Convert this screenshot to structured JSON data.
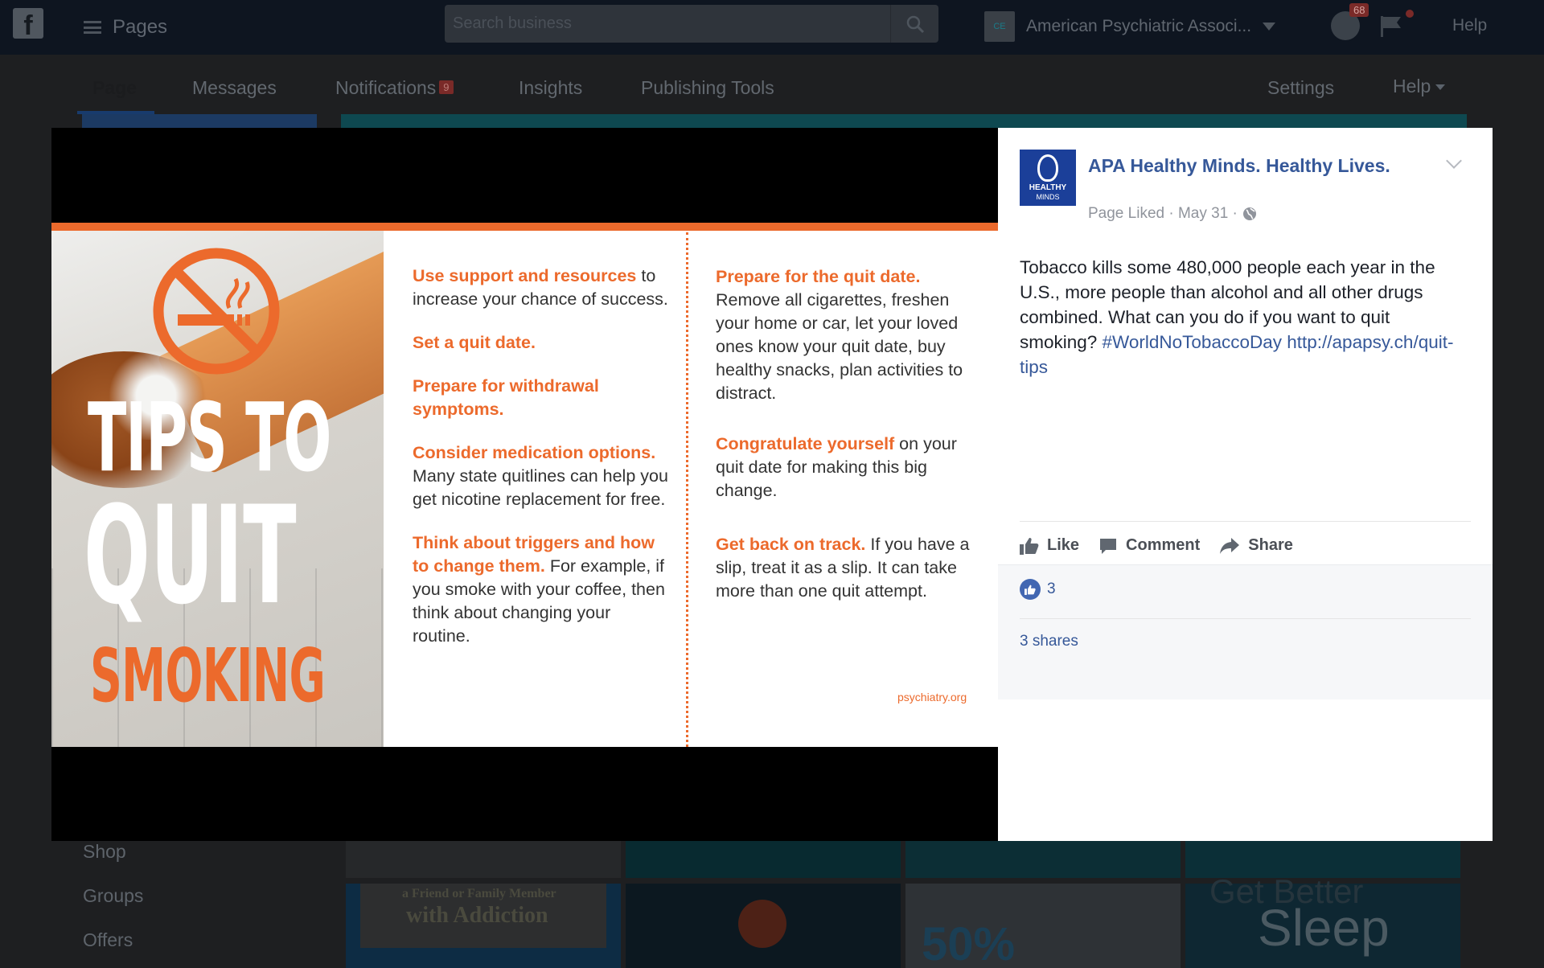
{
  "topbar": {
    "logo": "f",
    "pages_label": "Pages",
    "search_placeholder": "Search business",
    "account_avatar": "CE",
    "account_name": "American Psychiatric Associ...",
    "notifications_badge": "68",
    "help": "Help"
  },
  "subnav": {
    "tabs": [
      {
        "label": "Page"
      },
      {
        "label": "Messages"
      },
      {
        "label": "Notifications",
        "badge": "9"
      },
      {
        "label": "Insights"
      },
      {
        "label": "Publishing Tools"
      }
    ],
    "settings": "Settings",
    "help": "Help"
  },
  "sidebar": {
    "links": [
      "Shop",
      "Groups",
      "Offers"
    ]
  },
  "background_tiles": {
    "tile1_text": "a Friend or Family Member",
    "tile1_text2": "with Addiction",
    "tile2_text": "Get Better",
    "tile2_text2": "Sleep",
    "tile3_text": "50%"
  },
  "infographic": {
    "title_line1": "TIPS TO",
    "title_line2": "QUIT",
    "title_line3": "SMOKING",
    "col1": [
      {
        "highlight": "Use support and resources",
        "text": " to increase your chance of success."
      },
      {
        "highlight": "Set a quit date.",
        "text": ""
      },
      {
        "highlight": "Prepare for withdrawal symptoms.",
        "text": ""
      },
      {
        "highlight": "Consider medication options.",
        "text": " Many state quitlines can help you get nicotine replacement for free."
      },
      {
        "highlight": "Think about triggers and how to change them.",
        "text": " For example, if you smoke with your coffee, then think about changing your routine."
      }
    ],
    "col2": [
      {
        "highlight": "Prepare for the quit date.",
        "text": " Remove all cigarettes, freshen your home or car, let your loved ones know your quit date, buy healthy snacks, plan activities to distract."
      },
      {
        "highlight": "Congratulate yourself",
        "text": " on your quit date for making this big change."
      },
      {
        "highlight": "Get back on track.",
        "text": " If you have a slip, treat it as a slip. It can take more than one quit attempt."
      }
    ],
    "credit": "psychiatry.org"
  },
  "post": {
    "avatar_line1": "HEALTHY",
    "avatar_line2": "MINDS",
    "page_name": "APA Healthy Minds. Healthy Lives.",
    "meta": "Page Liked · May 31 ·",
    "text": "Tobacco kills some 480,000 people each year in the U.S., more people than alcohol and all other drugs combined. What can you do if you want to quit smoking? ",
    "hashtag": "#WorldNoTobaccoDay",
    "link": "http://apapsy.ch/quit-tips",
    "actions": {
      "like": "Like",
      "comment": "Comment",
      "share": "Share"
    },
    "like_count": "3",
    "shares": "3 shares"
  },
  "colors": {
    "accent_orange": "#ec6a2c",
    "fb_blue": "#365899",
    "modal_black": "#000000"
  }
}
